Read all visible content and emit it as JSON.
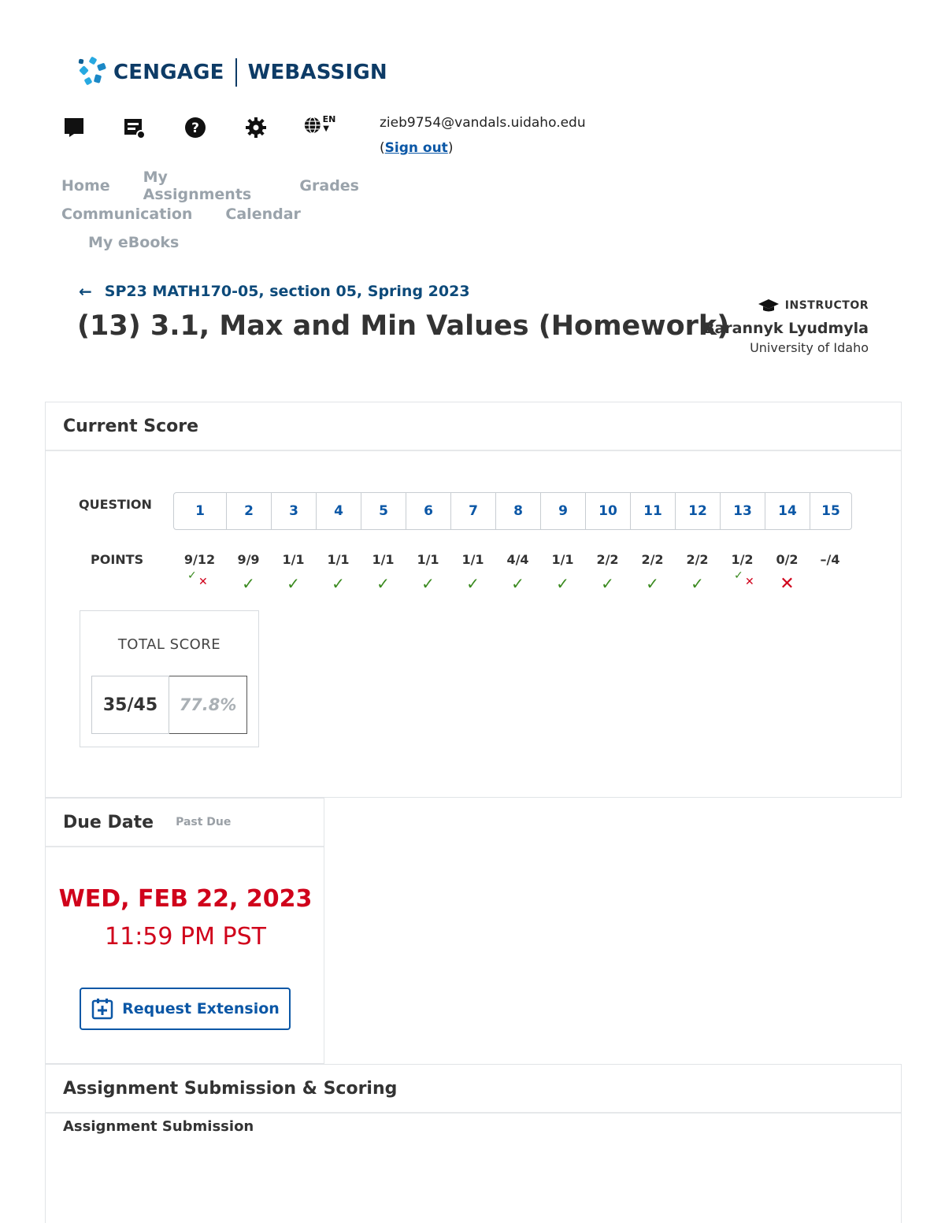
{
  "brand": {
    "name_left": "CENGAGE",
    "name_right": "WEBASSIGN"
  },
  "toolbar": {
    "icons": [
      "flag-icon",
      "grades-icon",
      "help-icon",
      "gear-icon",
      "globe-icon"
    ],
    "language_code": "EN"
  },
  "user": {
    "email": "zieb9754@vandals.uidaho.edu",
    "open_paren": "(",
    "signout": "Sign out",
    "close_paren": ")"
  },
  "nav": {
    "home": "Home",
    "my_assignments": "My Assignments",
    "grades": "Grades",
    "communication": "Communication",
    "calendar": "Calendar",
    "my_ebooks": "My eBooks"
  },
  "header": {
    "back_link": "SP23 MATH170-05, section 05, Spring 2023",
    "title": "(13) 3.1, Max and Min Values (Homework)",
    "instructor_label": "INSTRUCTOR",
    "instructor_name": "Barannyk Lyudmyla",
    "instructor_school": "University of Idaho"
  },
  "score": {
    "heading": "Current Score",
    "question_label": "QUESTION",
    "points_label": "POINTS",
    "questions": [
      "1",
      "2",
      "3",
      "4",
      "5",
      "6",
      "7",
      "8",
      "9",
      "10",
      "11",
      "12",
      "13",
      "14",
      "15"
    ],
    "points": [
      "9/12",
      "9/9",
      "1/1",
      "1/1",
      "1/1",
      "1/1",
      "1/1",
      "4/4",
      "1/1",
      "2/2",
      "2/2",
      "2/2",
      "1/2",
      "0/2",
      "–/4"
    ],
    "status": [
      "partial",
      "correct",
      "correct",
      "correct",
      "correct",
      "correct",
      "correct",
      "correct",
      "correct",
      "correct",
      "correct",
      "correct",
      "partial",
      "incorrect",
      "none"
    ],
    "total_label": "TOTAL SCORE",
    "total_points": "35/45",
    "total_percent": "77.8%"
  },
  "due": {
    "heading": "Due Date",
    "status": "Past Due",
    "date": "WED, FEB 22, 2023",
    "time": "11:59 PM PST",
    "extension_button": "Request Extension"
  },
  "submission": {
    "heading": "Assignment Submission & Scoring",
    "subheading": "Assignment Submission"
  },
  "colors": {
    "brand": "#0d3b66",
    "link": "#0b57a6",
    "correct": "#3a8a1f",
    "incorrect": "#d0021b"
  }
}
